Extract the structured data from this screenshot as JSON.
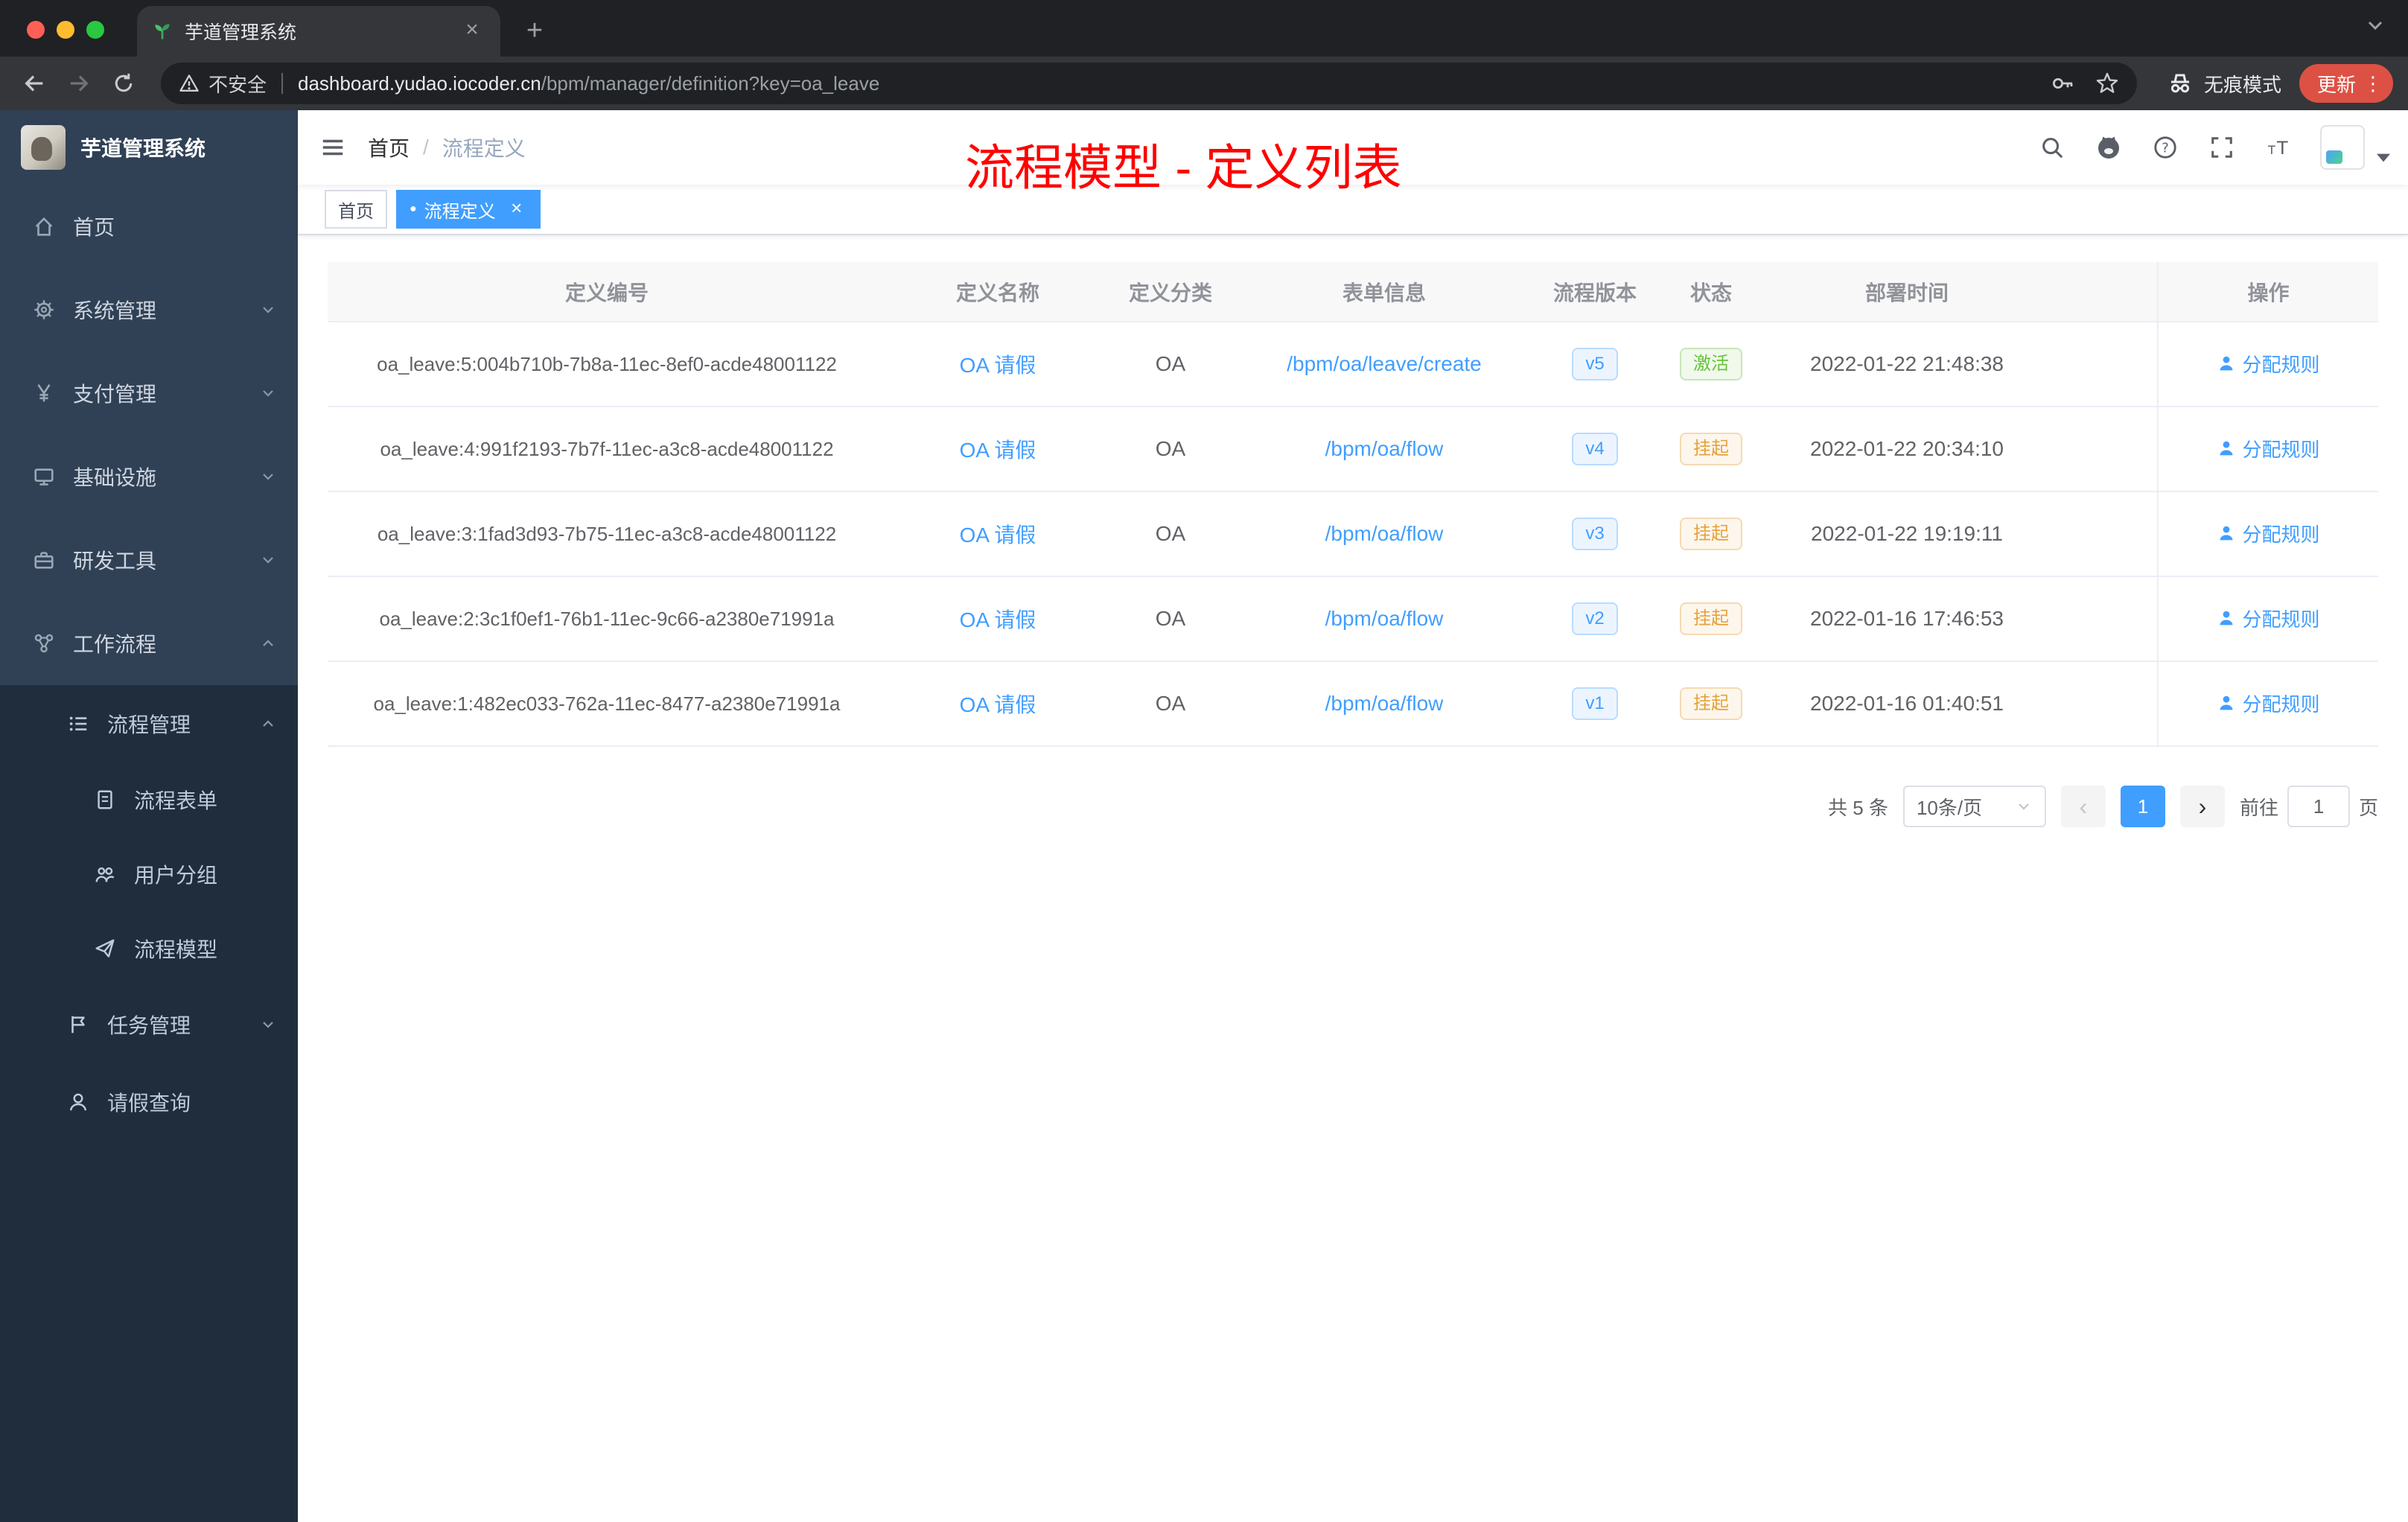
{
  "colors": {
    "accent": "#409eff",
    "overlay_red": "#ff0000",
    "sidebar_bg": "#304156",
    "submenu_bg": "#1f2d3d",
    "success": "#67c23a",
    "warning": "#e6a23c"
  },
  "icons": {
    "close": "×",
    "plus": "+",
    "dots": "⋮",
    "prev": "‹",
    "next": "›",
    "dot": "●"
  },
  "browser": {
    "tab_title": "芋道管理系统",
    "not_secure_label": "不安全",
    "url_host": "dashboard.yudao.iocoder.cn",
    "url_path": "/bpm/manager/definition?key=oa_leave",
    "incognito_label": "无痕模式",
    "update_label": "更新"
  },
  "sidebar": {
    "app_title": "芋道管理系统",
    "items": [
      {
        "label": "首页"
      },
      {
        "label": "系统管理"
      },
      {
        "label": "支付管理"
      },
      {
        "label": "基础设施"
      },
      {
        "label": "研发工具"
      },
      {
        "label": "工作流程"
      },
      {
        "label": "流程管理"
      },
      {
        "label": "流程表单"
      },
      {
        "label": "用户分组"
      },
      {
        "label": "流程模型"
      },
      {
        "label": "任务管理"
      },
      {
        "label": "请假查询"
      }
    ]
  },
  "navbar": {
    "breadcrumb_home": "首页",
    "separator": "/",
    "breadcrumb_current": "流程定义"
  },
  "overlay": {
    "title": "流程模型 - 定义列表"
  },
  "tags": {
    "home": "首页",
    "active": "流程定义"
  },
  "table": {
    "columns": [
      "定义编号",
      "定义名称",
      "定义分类",
      "表单信息",
      "流程版本",
      "状态",
      "部署时间",
      "操作"
    ],
    "action_label": "分配规则",
    "rows": [
      {
        "id": "oa_leave:5:004b710b-7b8a-11ec-8ef0-acde48001122",
        "name": "OA 请假",
        "category": "OA",
        "form": "/bpm/oa/leave/create",
        "version": "v5",
        "status": "激活",
        "status_type": "success",
        "time": "2022-01-22 21:48:38"
      },
      {
        "id": "oa_leave:4:991f2193-7b7f-11ec-a3c8-acde48001122",
        "name": "OA 请假",
        "category": "OA",
        "form": "/bpm/oa/flow",
        "version": "v4",
        "status": "挂起",
        "status_type": "warning",
        "time": "2022-01-22 20:34:10"
      },
      {
        "id": "oa_leave:3:1fad3d93-7b75-11ec-a3c8-acde48001122",
        "name": "OA 请假",
        "category": "OA",
        "form": "/bpm/oa/flow",
        "version": "v3",
        "status": "挂起",
        "status_type": "warning",
        "time": "2022-01-22 19:19:11"
      },
      {
        "id": "oa_leave:2:3c1f0ef1-76b1-11ec-9c66-a2380e71991a",
        "name": "OA 请假",
        "category": "OA",
        "form": "/bpm/oa/flow",
        "version": "v2",
        "status": "挂起",
        "status_type": "warning",
        "time": "2022-01-16 17:46:53"
      },
      {
        "id": "oa_leave:1:482ec033-762a-11ec-8477-a2380e71991a",
        "name": "OA 请假",
        "category": "OA",
        "form": "/bpm/oa/flow",
        "version": "v1",
        "status": "挂起",
        "status_type": "warning",
        "time": "2022-01-16 01:40:51"
      }
    ]
  },
  "pagination": {
    "total": "共 5 条",
    "page_size": "10条/页",
    "current_page": "1",
    "goto_label": "前往",
    "goto_value": "1",
    "page_label": "页"
  }
}
